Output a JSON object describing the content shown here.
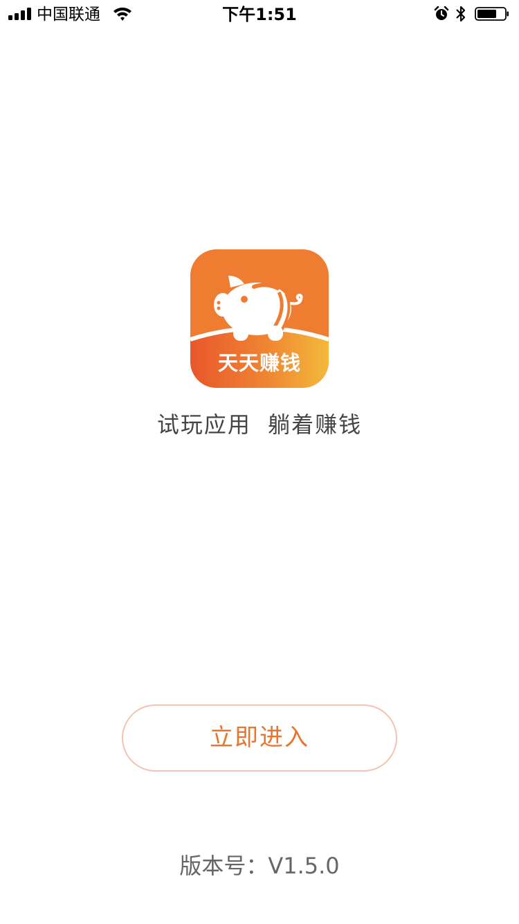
{
  "status_bar": {
    "carrier": "中国联通",
    "time": "下午1:51",
    "icons": [
      "signal-icon",
      "wifi-icon",
      "alarm-icon",
      "bluetooth-icon",
      "battery-icon"
    ]
  },
  "app": {
    "icon_label": "天天赚钱",
    "slogan": "试玩应用  躺着赚钱"
  },
  "actions": {
    "enter_label": "立即进入"
  },
  "footer": {
    "version": "版本号：V1.5.0"
  },
  "colors": {
    "brand_orange": "#EE7D32",
    "accent_red": "#E8572B",
    "accent_yellow": "#F4B93A",
    "button_border": "#F2C3AD",
    "button_text": "#E8752C"
  }
}
